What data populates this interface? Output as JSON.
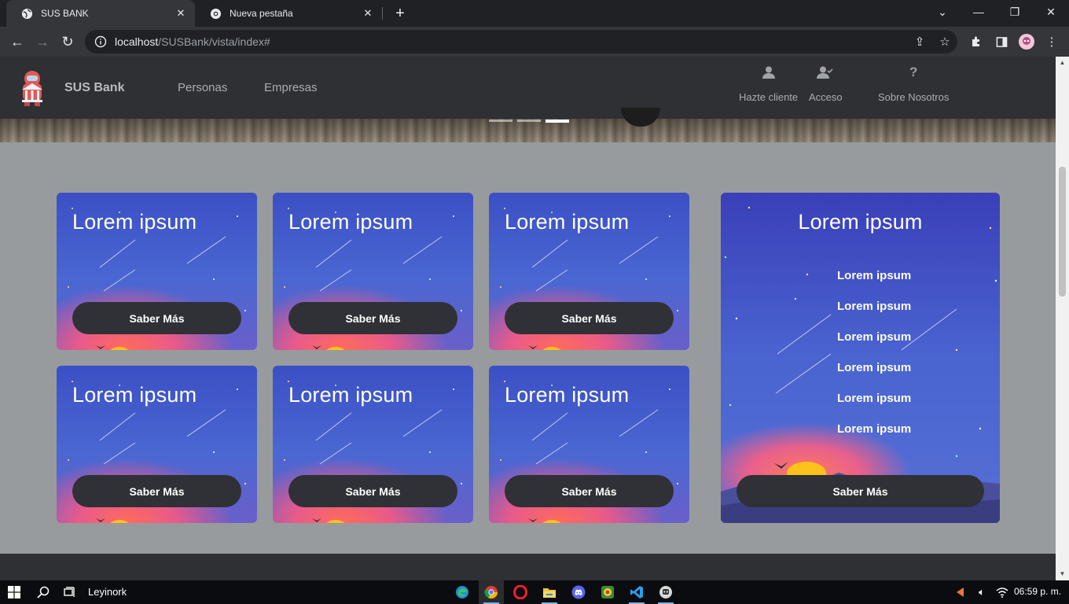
{
  "browser": {
    "tabs": [
      {
        "title": "SUS BANK",
        "active": true
      },
      {
        "title": "Nueva pestaña",
        "active": false
      }
    ],
    "url_host": "localhost",
    "url_path": "/SUSBank/vista/index#"
  },
  "site": {
    "brand": "SUS Bank",
    "nav_links": [
      "Personas",
      "Empresas"
    ],
    "actions": [
      {
        "label": "Hazte cliente",
        "icon": "user-icon"
      },
      {
        "label": "Acceso",
        "icon": "user-check-icon"
      },
      {
        "label": "Sobre Nosotros",
        "icon": "question-icon"
      }
    ]
  },
  "cards": [
    {
      "title": "Lorem ipsum",
      "button": "Saber Más"
    },
    {
      "title": "Lorem ipsum",
      "button": "Saber Más"
    },
    {
      "title": "Lorem ipsum",
      "button": "Saber Más"
    },
    {
      "title": "Lorem ipsum",
      "button": "Saber Más"
    },
    {
      "title": "Lorem ipsum",
      "button": "Saber Más"
    },
    {
      "title": "Lorem ipsum",
      "button": "Saber Más"
    }
  ],
  "featured": {
    "title": "Lorem ipsum",
    "items": [
      "Lorem ipsum",
      "Lorem ipsum",
      "Lorem ipsum",
      "Lorem ipsum",
      "Lorem ipsum",
      "Lorem ipsum"
    ],
    "button": "Saber Más"
  },
  "taskbar": {
    "user": "Leyinork",
    "clock": "06:59 p. m."
  }
}
